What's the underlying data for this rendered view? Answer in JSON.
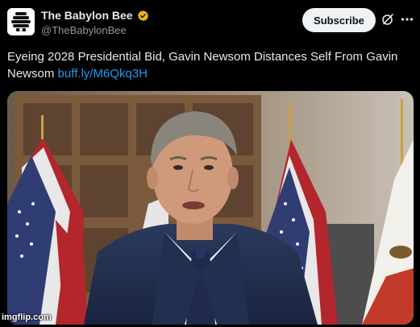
{
  "account": {
    "display_name": "The Babylon Bee",
    "handle": "@TheBabylonBee",
    "avatar_icon": "bee-hive-logo",
    "verified_icon": "gold-verified-badge-icon",
    "verified_color": "#e2b719"
  },
  "actions": {
    "subscribe_label": "Subscribe",
    "grok_icon": "grok-icon",
    "more_icon": "more-options-icon"
  },
  "post": {
    "text": "Eyeing 2028 Presidential Bid, Gavin Newsom Distances Self From Gavin Newsom",
    "link": "buff.ly/M6Qkq3H"
  },
  "media": {
    "description_icon": "press-conference-photo"
  },
  "watermark": {
    "text": "imgflip.com"
  },
  "colors": {
    "background": "#000000",
    "text": "#e7e9ea",
    "secondary": "#8b98a5",
    "link": "#1d9bf0",
    "button_bg": "#eff3f4"
  }
}
